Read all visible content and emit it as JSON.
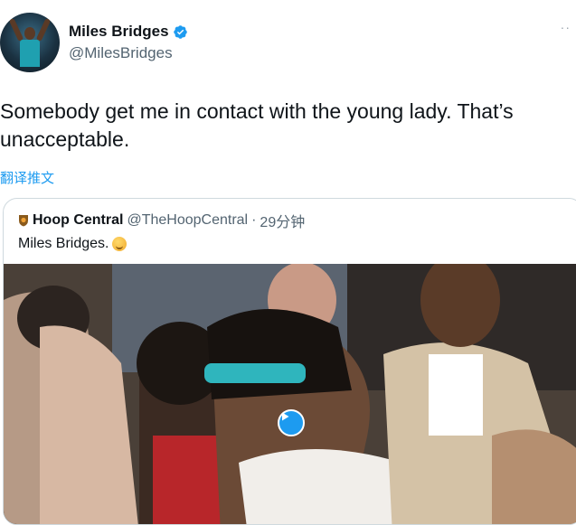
{
  "author": {
    "display_name": "Miles Bridges",
    "handle": "@MilesBridges",
    "avatar_icon": "user-avatar",
    "verified_icon": "verified-badge-icon"
  },
  "tweet": {
    "text": "Somebody get me in contact with the young lady. That’s unacceptable.",
    "translate_label": "翻译推文"
  },
  "quoted_tweet": {
    "display_name": "Hoop Central",
    "handle": "@TheHoopCentral",
    "separator": "·",
    "time": "29分钟",
    "text": "Miles Bridges.",
    "emoji_icon": "grinning-face-icon",
    "media_icon": "play-video-icon"
  },
  "colors": {
    "accent": "#1d9bf0",
    "text_primary": "#0f1419",
    "text_secondary": "#536471",
    "border": "#cfd9de"
  }
}
